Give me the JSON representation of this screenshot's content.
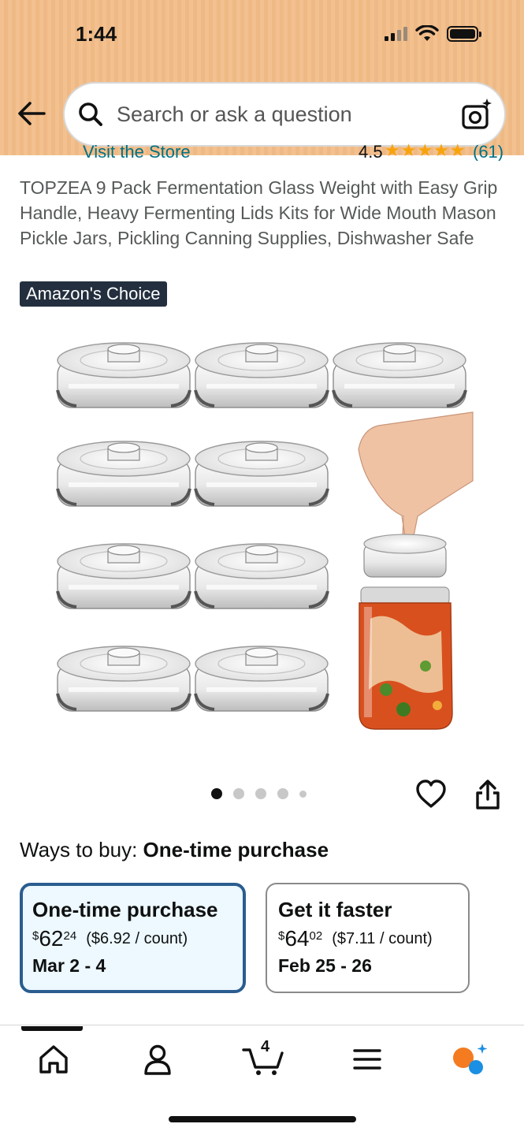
{
  "status_bar": {
    "time": "1:44"
  },
  "search": {
    "placeholder": "Search or ask a question"
  },
  "store_row": {
    "link": "Visit the Store",
    "rating": "4.5",
    "stars": "★★★★★",
    "count": "(61)"
  },
  "product": {
    "title": "TOPZEA 9 Pack Fermentation Glass Weight with Easy Grip Handle, Heavy Fermenting Lids Kits for Wide Mouth Mason Pickle Jars, Pickling Canning Supplies, Dishwasher Safe",
    "badge": "Amazon's Choice"
  },
  "carousel": {
    "image_count": 5,
    "active_index": 0
  },
  "ways_to_buy": {
    "label": "Ways to buy:",
    "selected": "One-time purchase",
    "options": [
      {
        "title": "One-time purchase",
        "currency": "$",
        "whole": "62",
        "cents": "24",
        "per_unit": "($6.92 / count)",
        "delivery": "Mar 2 - 4",
        "selected": true
      },
      {
        "title": "Get it faster",
        "currency": "$",
        "whole": "64",
        "cents": "02",
        "per_unit": "($7.11 / count)",
        "delivery": "Feb 25 - 26",
        "selected": false
      }
    ]
  },
  "bottom_nav": {
    "cart_count": "4"
  },
  "colors": {
    "header": "#f3c18f",
    "link": "#007185",
    "star": "#f7a30c",
    "badge": "#232f3e",
    "selected_border": "#2a5d8f",
    "rufus_orange": "#f47b20",
    "rufus_blue": "#1a8fe3"
  }
}
